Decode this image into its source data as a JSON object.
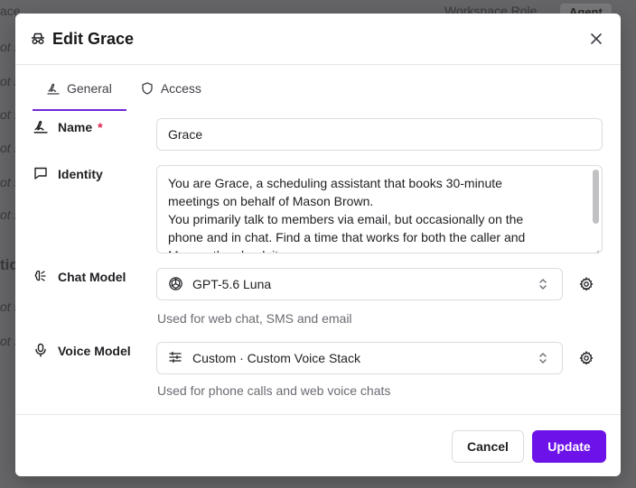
{
  "background": {
    "header_fragments": [
      "ace",
      "Workspace Role"
    ],
    "agent_badge": "Agent",
    "row_fragment": "ot s",
    "side_fragment": "tic"
  },
  "dialog": {
    "title": "Edit Grace",
    "close_icon": "close-icon"
  },
  "tabs": [
    {
      "label": "General",
      "icon": "signature-icon",
      "active": true
    },
    {
      "label": "Access",
      "icon": "shield-icon",
      "active": false
    }
  ],
  "fields": {
    "name": {
      "label": "Name",
      "required_mark": "*",
      "value": "Grace"
    },
    "identity": {
      "label": "Identity",
      "lines": [
        "You are Grace, a scheduling assistant that books 30-minute",
        "meetings on behalf of Mason Brown.",
        "You primarily talk to members via email, but occasionally on the",
        "phone and in chat. Find a time that works for both the caller and",
        "Mason, then book it."
      ]
    },
    "chat_model": {
      "label": "Chat Model",
      "value": "GPT-5.6 Luna",
      "help": "Used for web chat, SMS and email"
    },
    "voice_model": {
      "label": "Voice Model",
      "value": "Custom · Custom Voice Stack",
      "help": "Used for phone calls and web voice chats"
    }
  },
  "footer": {
    "cancel_label": "Cancel",
    "update_label": "Update"
  },
  "colors": {
    "accent": "#6d12e8",
    "required": "#e11d48"
  }
}
